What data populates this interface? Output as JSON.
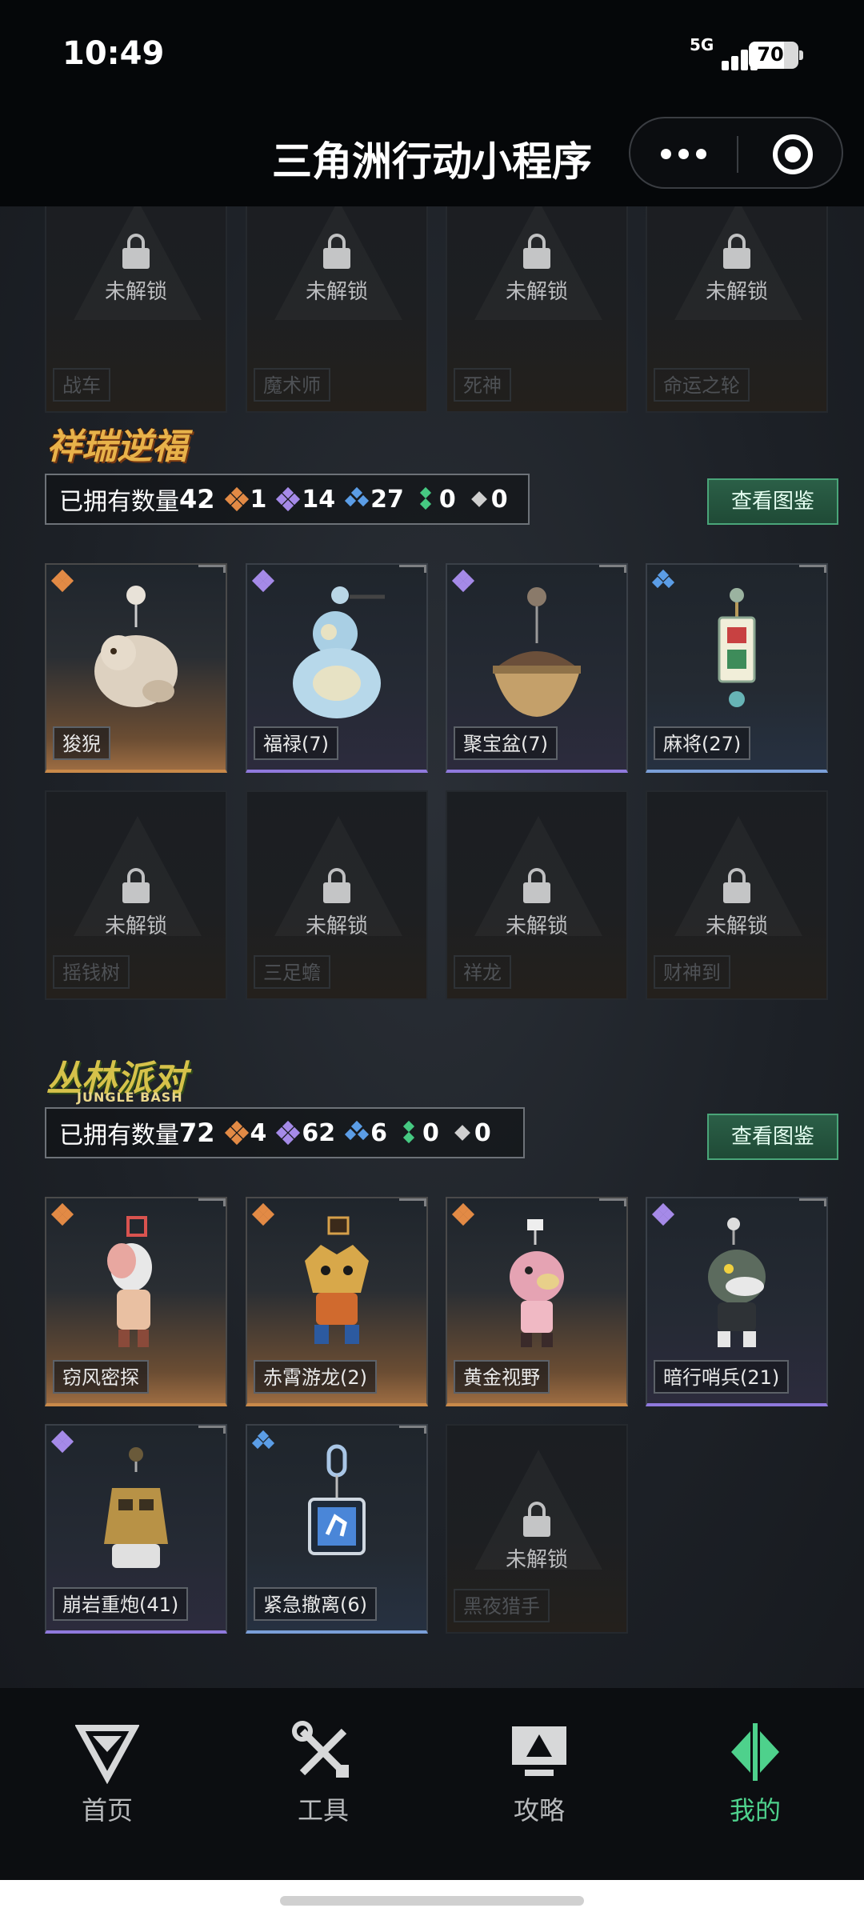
{
  "status": {
    "time": "10:49",
    "network": "5G",
    "battery": "70"
  },
  "header": {
    "title": "三角洲行动小程序"
  },
  "top_locked_row": [
    {
      "name": "战车",
      "state": "未解锁"
    },
    {
      "name": "魔术师",
      "state": "未解锁"
    },
    {
      "name": "死神",
      "state": "未解锁"
    },
    {
      "name": "命运之轮",
      "state": "未解锁"
    }
  ],
  "section1": {
    "logo": "祥瑞逆福",
    "owned_label": "已拥有数量",
    "owned_total": "42",
    "counts": [
      {
        "rarity": "orange",
        "value": "1"
      },
      {
        "rarity": "purple",
        "value": "14"
      },
      {
        "rarity": "blue",
        "value": "27"
      },
      {
        "rarity": "green",
        "value": "0"
      },
      {
        "rarity": "white",
        "value": "0"
      }
    ],
    "catalog_button": "查看图鉴",
    "items": [
      {
        "name": "狻猊",
        "rarity": "gold"
      },
      {
        "name": "福禄(7)",
        "rarity": "purple"
      },
      {
        "name": "聚宝盆(7)",
        "rarity": "purple"
      },
      {
        "name": "麻将(27)",
        "rarity": "blue"
      },
      {
        "name": "摇钱树",
        "state": "未解锁"
      },
      {
        "name": "三足蟾",
        "state": "未解锁"
      },
      {
        "name": "祥龙",
        "state": "未解锁"
      },
      {
        "name": "财神到",
        "state": "未解锁"
      }
    ]
  },
  "section2": {
    "logo": "丛林派对",
    "logo_sub": "JUNGLE BASH",
    "owned_label": "已拥有数量",
    "owned_total": "72",
    "counts": [
      {
        "rarity": "orange",
        "value": "4"
      },
      {
        "rarity": "purple",
        "value": "62"
      },
      {
        "rarity": "blue",
        "value": "6"
      },
      {
        "rarity": "green",
        "value": "0"
      },
      {
        "rarity": "white",
        "value": "0"
      }
    ],
    "catalog_button": "查看图鉴",
    "items": [
      {
        "name": "窃风密探",
        "rarity": "gold"
      },
      {
        "name": "赤霄游龙(2)",
        "rarity": "gold"
      },
      {
        "name": "黄金视野",
        "rarity": "gold"
      },
      {
        "name": "暗行哨兵(21)",
        "rarity": "purple"
      },
      {
        "name": "崩岩重炮(41)",
        "rarity": "purple"
      },
      {
        "name": "紧急撤离(6)",
        "rarity": "blue"
      },
      {
        "name": "黑夜猎手",
        "state": "未解锁"
      }
    ]
  },
  "tabbar": [
    {
      "label": "首页",
      "icon": "home-triangle-icon"
    },
    {
      "label": "工具",
      "icon": "tools-icon"
    },
    {
      "label": "攻略",
      "icon": "guide-monitor-icon"
    },
    {
      "label": "我的",
      "icon": "profile-logo-icon",
      "active": true
    }
  ],
  "colors": {
    "gold": "#c98949",
    "purple": "#8f79dd",
    "blue": "#7a9fd8",
    "accent_green": "#4ed18c",
    "gem_orange": "#e28a45",
    "gem_purple": "#a58ae8",
    "gem_blue": "#5b9de6",
    "gem_green": "#46c982",
    "gem_white": "#cfcfcf"
  }
}
